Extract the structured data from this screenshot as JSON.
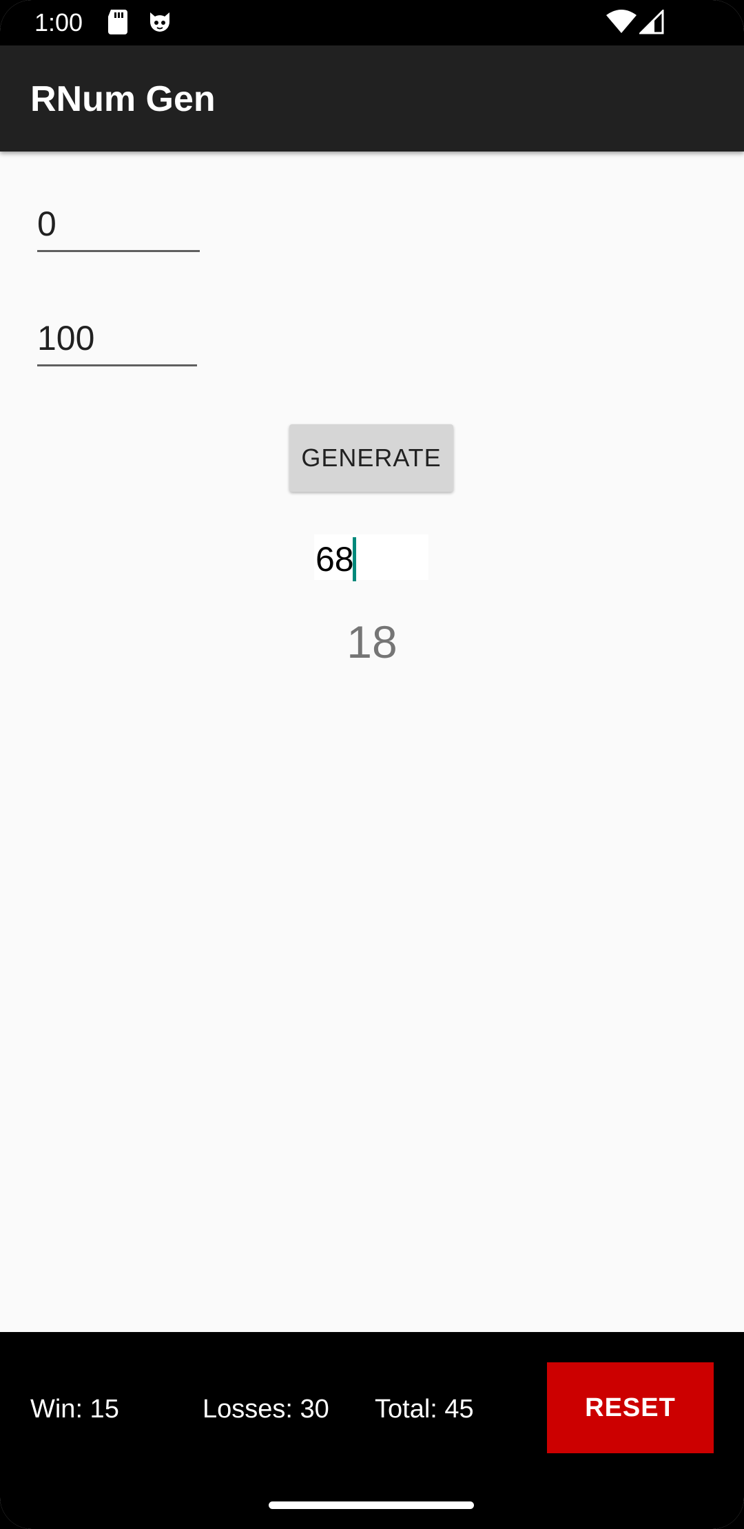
{
  "status_bar": {
    "time": "1:00",
    "icons": [
      "sd-card-icon",
      "cat-icon",
      "wifi-icon",
      "signal-icon"
    ]
  },
  "app_bar": {
    "title": "RNum Gen"
  },
  "form": {
    "min_value": "0",
    "max_value": "100",
    "generate_label": "GENERATE",
    "guess_value": "68",
    "result": "18"
  },
  "stats": {
    "win": "Win: 15",
    "losses": "Losses: 30",
    "total": "Total: 45",
    "reset_label": "RESET"
  },
  "colors": {
    "app_bar": "#212121",
    "background": "#fafafa",
    "accent": "#00897b",
    "reset": "#cc0000",
    "bottom_bar": "#000000"
  }
}
